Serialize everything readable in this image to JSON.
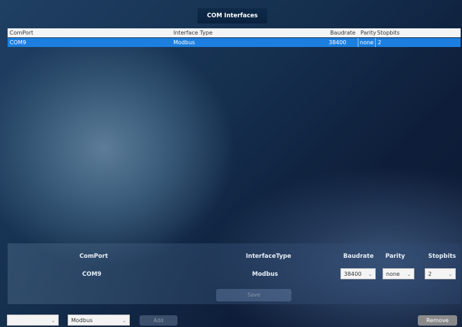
{
  "window": {
    "title": "COM Interfaces"
  },
  "table": {
    "columns": [
      "ComPort",
      "Interface Type",
      "Baudrate",
      "Parity",
      "Stopbits"
    ],
    "rows": [
      {
        "comport": "COM9",
        "interface_type": "Modbus",
        "baudrate": "38400",
        "parity": "none",
        "stopbits": "2",
        "selected": true
      }
    ]
  },
  "detail": {
    "labels": {
      "comport": "ComPort",
      "interface_type": "InterfaceType",
      "baudrate": "Baudrate",
      "parity": "Parity",
      "stopbits": "Stopbits"
    },
    "values": {
      "comport": "COM9",
      "interface_type": "Modbus",
      "baudrate": "38400",
      "parity": "none",
      "stopbits": "2"
    },
    "save_label": "Save"
  },
  "footer": {
    "port_select": "",
    "type_select": "Modbus",
    "add_label": "Add",
    "remove_label": "Remove"
  },
  "colors": {
    "selection": "#1c7fe0",
    "header_bg": "#f2f4f6",
    "title_bg": "#0e2a48"
  },
  "icons": {
    "dropdown": "chevron-down-icon"
  }
}
